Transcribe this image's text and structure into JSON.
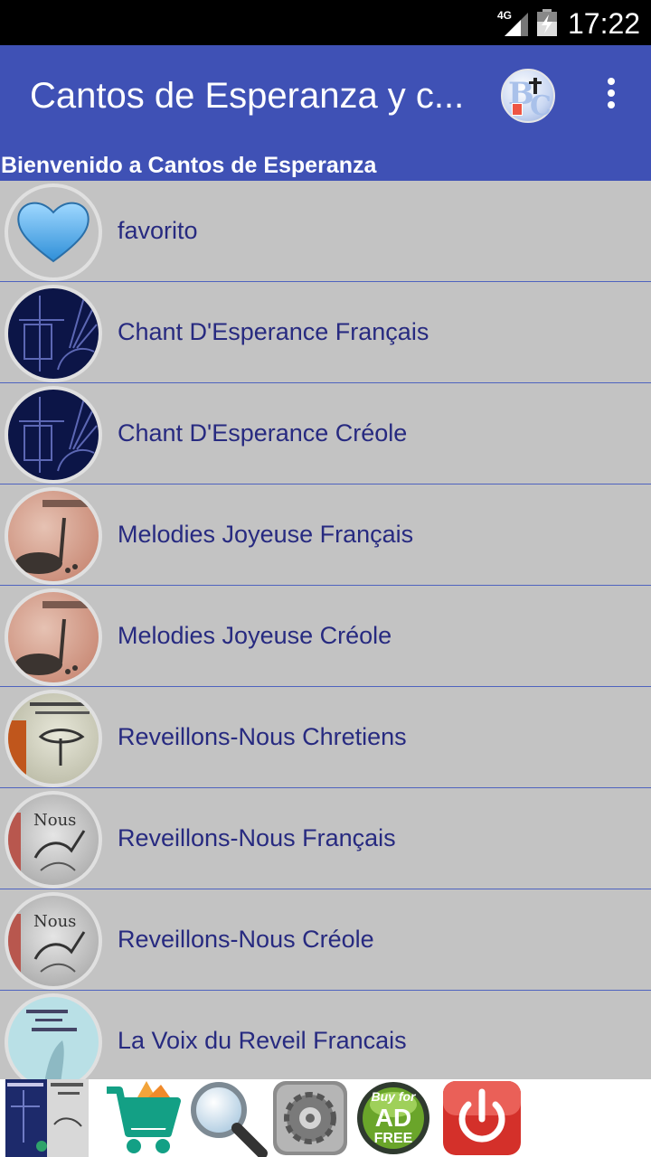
{
  "status_bar": {
    "network": "4G",
    "time": "17:22"
  },
  "app_bar": {
    "title": "Cantos de Esperanza y c...",
    "logo_icon": "bc-logo-icon",
    "menu_icon": "overflow-menu-icon"
  },
  "welcome_text": "Bienvenido a Cantos de Esperanza",
  "items": [
    {
      "label": "favorito",
      "icon": "heart-icon"
    },
    {
      "label": "Chant D'Esperance Français",
      "icon": "chant-cover-icon"
    },
    {
      "label": "Chant D'Esperance Créole",
      "icon": "chant-cover-icon"
    },
    {
      "label": "Melodies Joyeuse Français",
      "icon": "melodies-cover-icon"
    },
    {
      "label": "Melodies Joyeuse Créole",
      "icon": "melodies-cover-icon"
    },
    {
      "label": "Reveillons-Nous Chretiens",
      "icon": "reveillons-cover-icon"
    },
    {
      "label": "Reveillons-Nous Français",
      "icon": "reveillons-cover-icon"
    },
    {
      "label": "Reveillons-Nous Créole",
      "icon": "reveillons-cover-icon"
    },
    {
      "label": "La Voix du Reveil Francais",
      "icon": "voix-cover-icon"
    }
  ],
  "bottom_bar": {
    "books_icon": "books-icon",
    "cart_icon": "shopping-cart-icon",
    "search_icon": "magnifier-icon",
    "settings_icon": "gear-icon",
    "adfree_badge": {
      "line1": "Buy for",
      "line2": "AD",
      "line3": "FREE"
    },
    "power_icon": "power-icon"
  },
  "colors": {
    "primary": "#3f51b5",
    "list_bg": "#c3c3c3",
    "item_text": "#272a80"
  }
}
